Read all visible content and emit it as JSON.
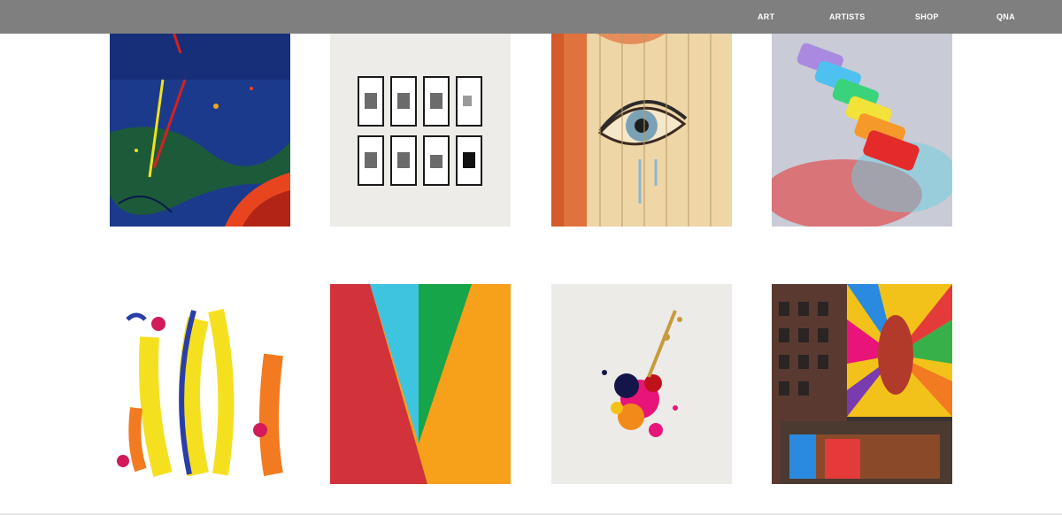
{
  "nav": {
    "items": [
      {
        "label": "ART"
      },
      {
        "label": "ARTISTS"
      },
      {
        "label": "SHOP"
      },
      {
        "label": "QNA"
      }
    ]
  },
  "gallery": {
    "images": [
      {
        "icon": "abstract-blue-splatter-painting"
      },
      {
        "icon": "framed-photos-wall"
      },
      {
        "icon": "eye-mural-on-fence"
      },
      {
        "icon": "colorful-chalk-pastels"
      },
      {
        "icon": "brush-stroke-abstract"
      },
      {
        "icon": "geometric-color-blocks"
      },
      {
        "icon": "paint-splash"
      },
      {
        "icon": "street-mural-building"
      }
    ]
  },
  "colors": {
    "navbar": "#7f7f7f",
    "nav_text": "#ffffff",
    "background": "#ffffff"
  }
}
